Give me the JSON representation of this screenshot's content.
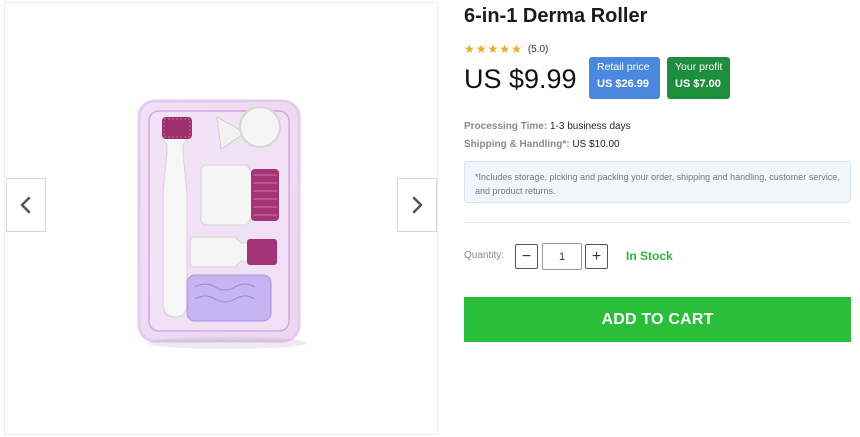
{
  "product": {
    "title": "6-in-1 Derma Roller",
    "rating_text": "(5.0)",
    "star_count": 5,
    "price": "US $9.99",
    "retail": {
      "label": "Retail price",
      "value": "US $26.99",
      "color": "#4a88e0"
    },
    "profit": {
      "label": "Your profit",
      "value": "US $7.00",
      "color": "#1d8f3c"
    }
  },
  "details": {
    "processing_label": "Processing Time:",
    "processing_value": " 1-3 business days",
    "shipping_label": "Shipping & Handling*:",
    "shipping_value": " US $10.00",
    "note": "*Includes storage, picking and packing your order, shipping and handling, customer service, and product returns."
  },
  "quantity": {
    "label": "Quantity:",
    "value": "1",
    "minus": "−",
    "plus": "+"
  },
  "stock": "In Stock",
  "cart_button": "ADD TO CART",
  "icons": {
    "prev": "chevron-left-icon",
    "next": "chevron-right-icon",
    "star": "star-icon"
  },
  "colors": {
    "accent_green": "#29bf38",
    "stock_green": "#2db83d",
    "star": "#f5a623"
  }
}
